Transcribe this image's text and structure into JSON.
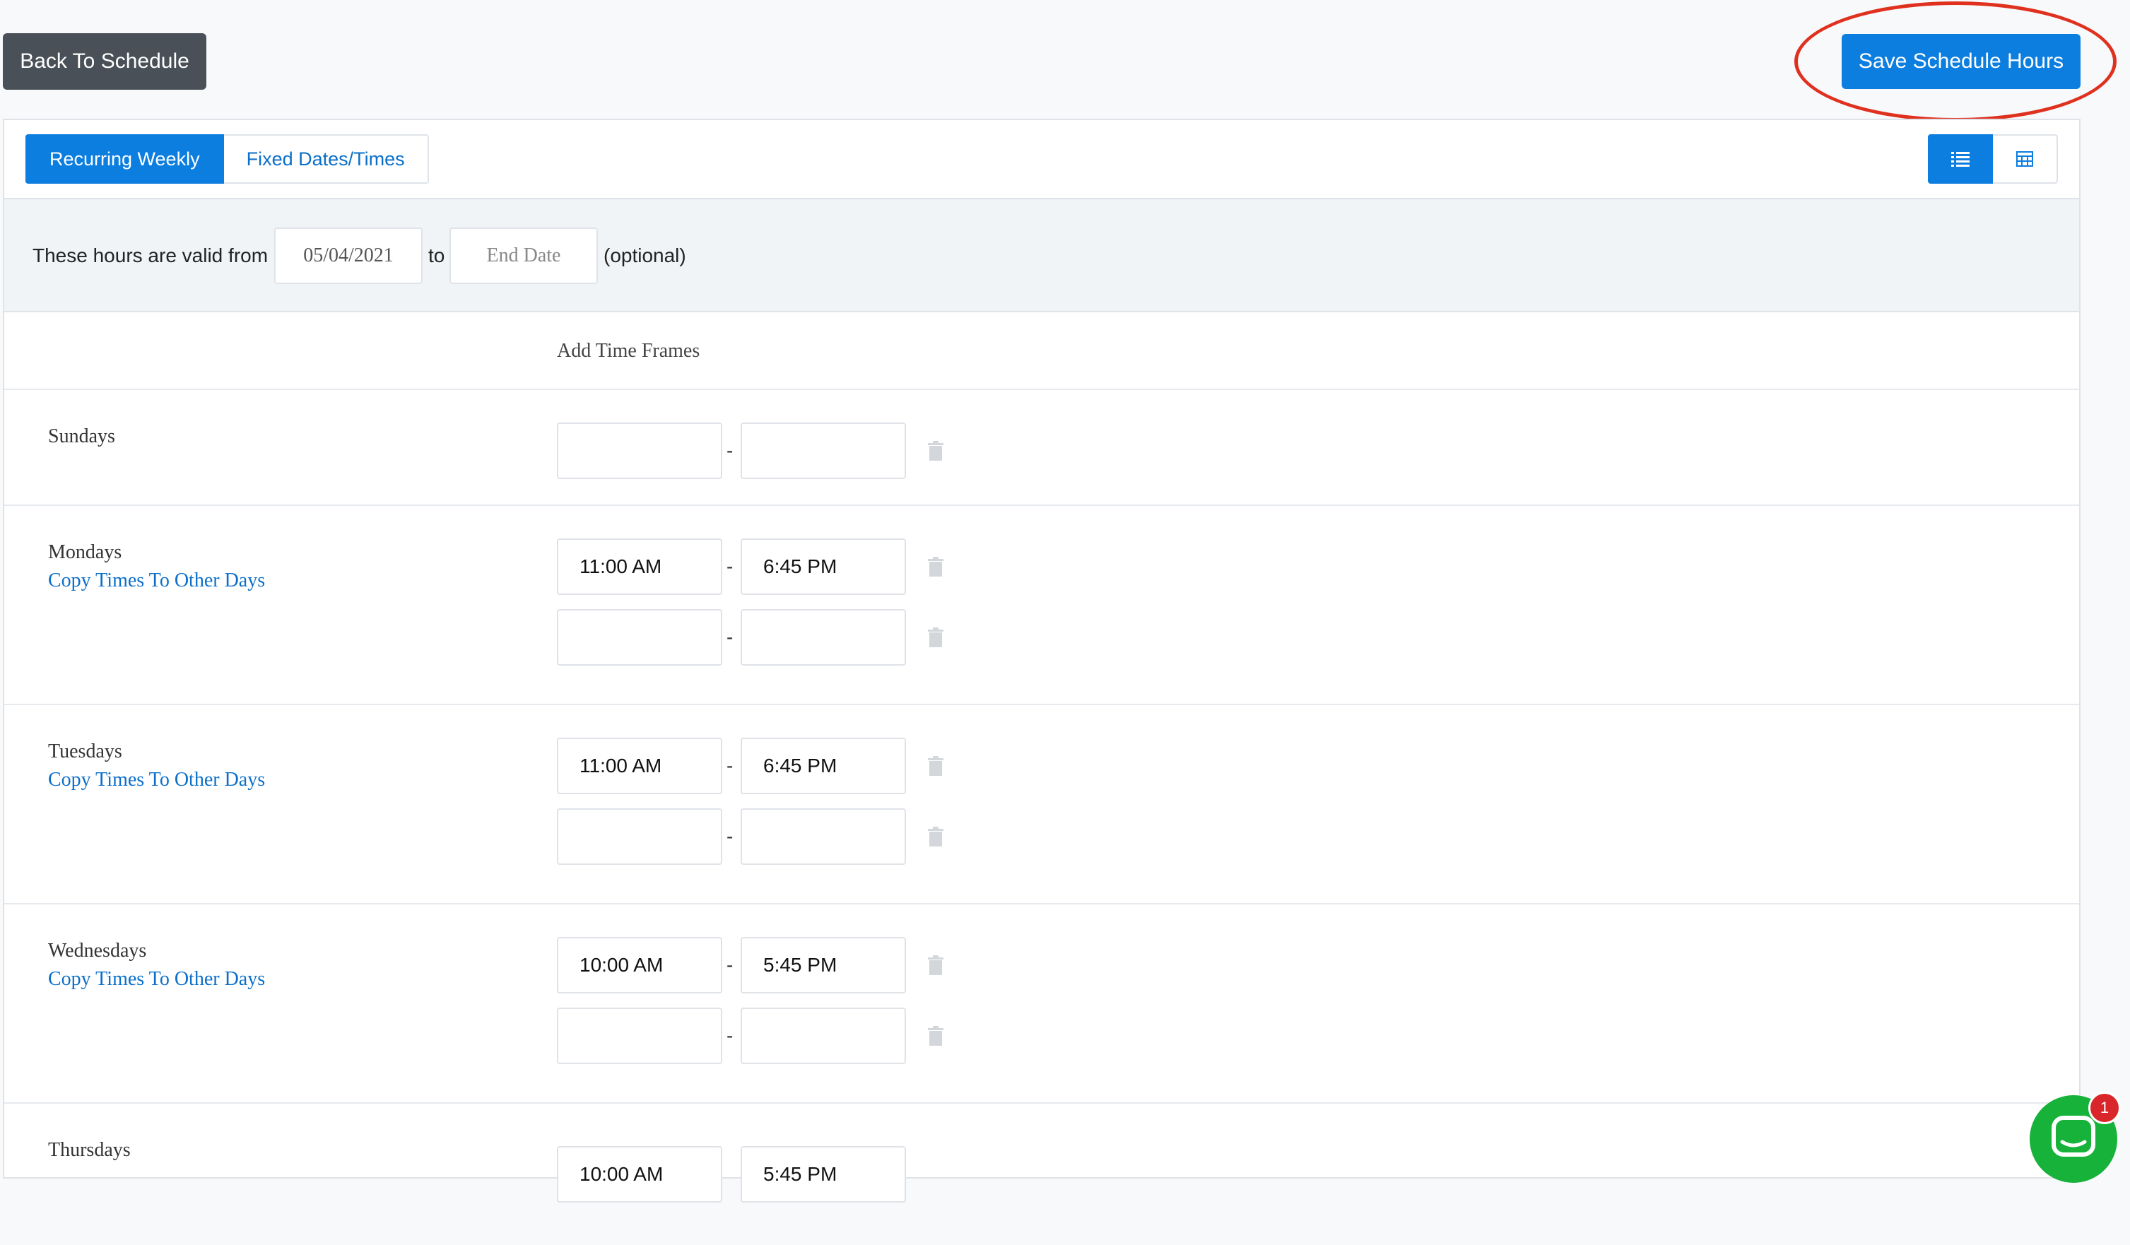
{
  "toolbar": {
    "back_label": "Back To Schedule",
    "save_label": "Save Schedule Hours"
  },
  "tabs": [
    {
      "label": "Recurring Weekly",
      "active": true
    },
    {
      "label": "Fixed Dates/Times",
      "active": false
    }
  ],
  "view_toggle": [
    {
      "icon": "list-icon",
      "active": true
    },
    {
      "icon": "table-grid-icon",
      "active": false
    }
  ],
  "validity": {
    "prefix": "These hours are valid from",
    "start_date": "05/04/2021",
    "connector": "to",
    "end_date_placeholder": "End Date",
    "suffix": "(optional)"
  },
  "table": {
    "column_title": "Add Time Frames",
    "copy_label": "Copy Times To Other Days",
    "separator": "-"
  },
  "days": [
    {
      "name": "Sundays",
      "frames": [
        [
          "",
          ""
        ]
      ]
    },
    {
      "name": "Mondays",
      "frames": [
        [
          "11:00 AM",
          "6:45 PM"
        ],
        [
          "",
          ""
        ]
      ]
    },
    {
      "name": "Tuesdays",
      "frames": [
        [
          "11:00 AM",
          "6:45 PM"
        ],
        [
          "",
          ""
        ]
      ]
    },
    {
      "name": "Wednesdays",
      "frames": [
        [
          "10:00 AM",
          "5:45 PM"
        ],
        [
          "",
          ""
        ]
      ]
    },
    {
      "name": "Thursdays",
      "frames": [
        [
          "10:00 AM",
          "5:45 PM"
        ]
      ]
    }
  ],
  "chat": {
    "badge_count": "1",
    "icon": "chat-icon"
  },
  "colors": {
    "primary": "#0b7ee0",
    "dark_button": "#4a5058",
    "highlight": "#e0301e",
    "chat": "#17b239"
  }
}
